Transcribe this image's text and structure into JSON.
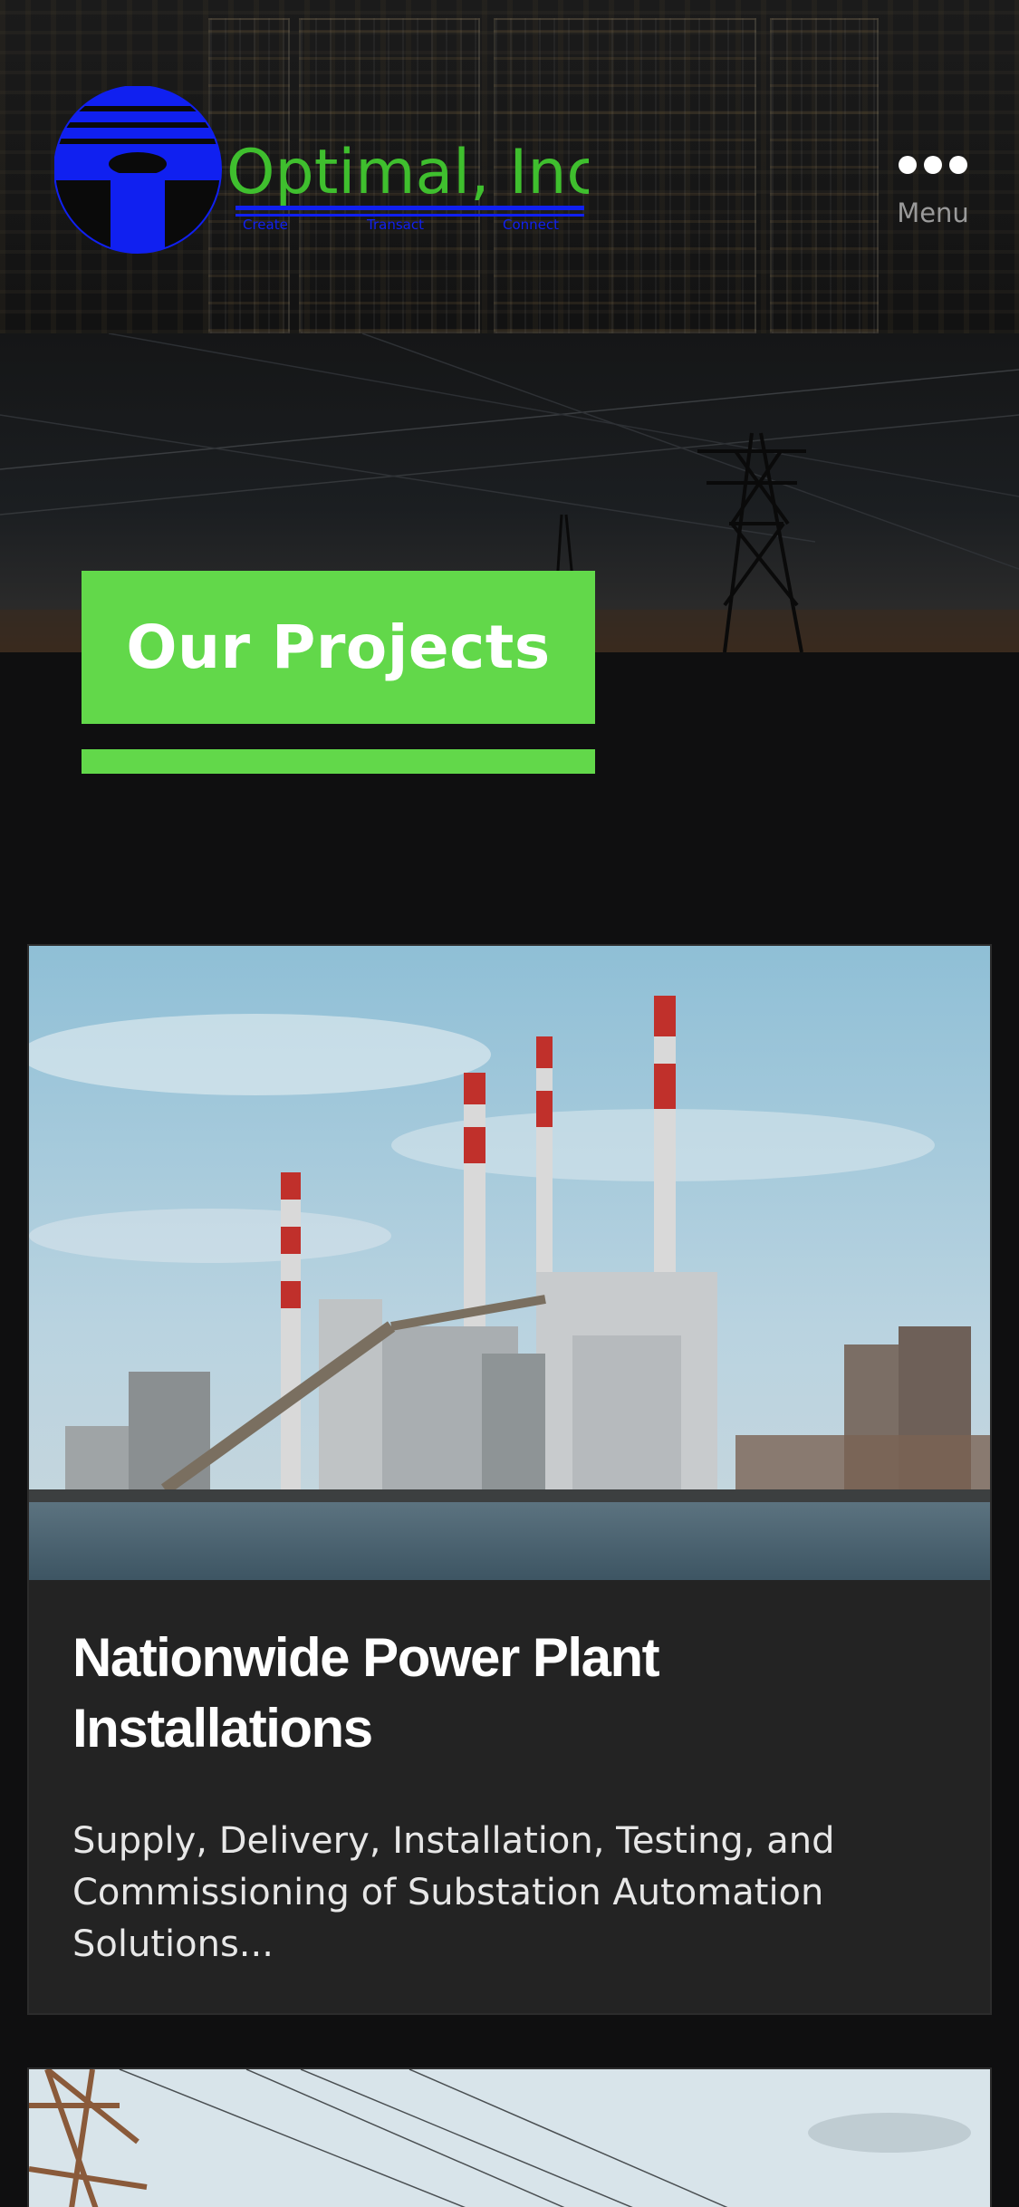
{
  "header": {
    "logo": {
      "company_name": "Optimal, Inc",
      "taglines": [
        "Create",
        "Transact",
        "Connect"
      ],
      "colors": {
        "blue": "#1020f0",
        "green": "#3fbf2e"
      }
    },
    "menu": {
      "label": "Menu",
      "icon": "ellipsis-icon"
    }
  },
  "hero": {
    "title": "Our Projects",
    "accent_color": "#62d84a"
  },
  "projects": [
    {
      "image": "power-plant-photo",
      "title": "Nationwide Power Plant Installations",
      "description": "Supply, Delivery, Installation, Testing, and Commissioning of Substation Automation Solutions..."
    },
    {
      "image": "power-lines-photo"
    }
  ]
}
